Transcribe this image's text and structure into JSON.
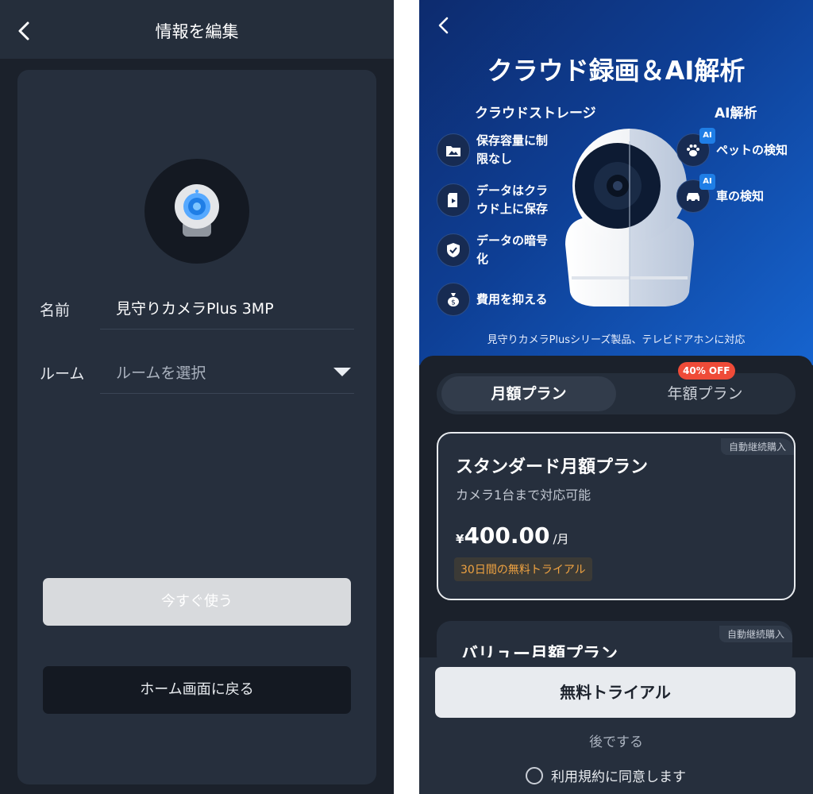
{
  "left": {
    "title": "情報を編集",
    "name_label": "名前",
    "name_value": "見守りカメラPlus 3MP",
    "room_label": "ルーム",
    "room_placeholder": "ルームを選択",
    "use_now": "今すぐ使う",
    "back_home": "ホーム画面に戻る"
  },
  "right": {
    "title": "クラウド録画＆AI解析",
    "cloud_heading": "クラウドストレージ",
    "ai_heading": "AI解析",
    "cloud_features": [
      {
        "line1": "保存容量に制",
        "line2": "限なし",
        "icon": "folder-image-icon"
      },
      {
        "line1": "データはクラ",
        "line2": "ウド上に保存",
        "icon": "sd-card-icon"
      },
      {
        "line1": "データの暗号",
        "line2": "化",
        "icon": "shield-check-icon"
      },
      {
        "line1": "費用を抑える",
        "line2": "",
        "icon": "money-bag-icon"
      }
    ],
    "ai_features": [
      {
        "label": "ペットの検知",
        "badge": "AI",
        "icon": "paw-icon"
      },
      {
        "label": "車の検知",
        "badge": "AI",
        "icon": "car-icon"
      }
    ],
    "compat_note": "見守りカメラPlusシリーズ製品、テレビドアホンに対応",
    "tabs": {
      "monthly": "月額プラン",
      "yearly": "年額プラン",
      "discount": "40% OFF"
    },
    "plans": [
      {
        "auto_renew": "自動継続購入",
        "name": "スタンダード月額プラン",
        "subtitle": "カメラ1台まで対応可能",
        "currency": "¥",
        "price": "400.00",
        "unit": "/月",
        "trial": "30日間の無料トライアル"
      },
      {
        "auto_renew": "自動継続購入",
        "name": "バリュー月額プラン"
      }
    ],
    "free_trial": "無料トライアル",
    "later": "後でする",
    "agree": "利用規約に同意します"
  }
}
